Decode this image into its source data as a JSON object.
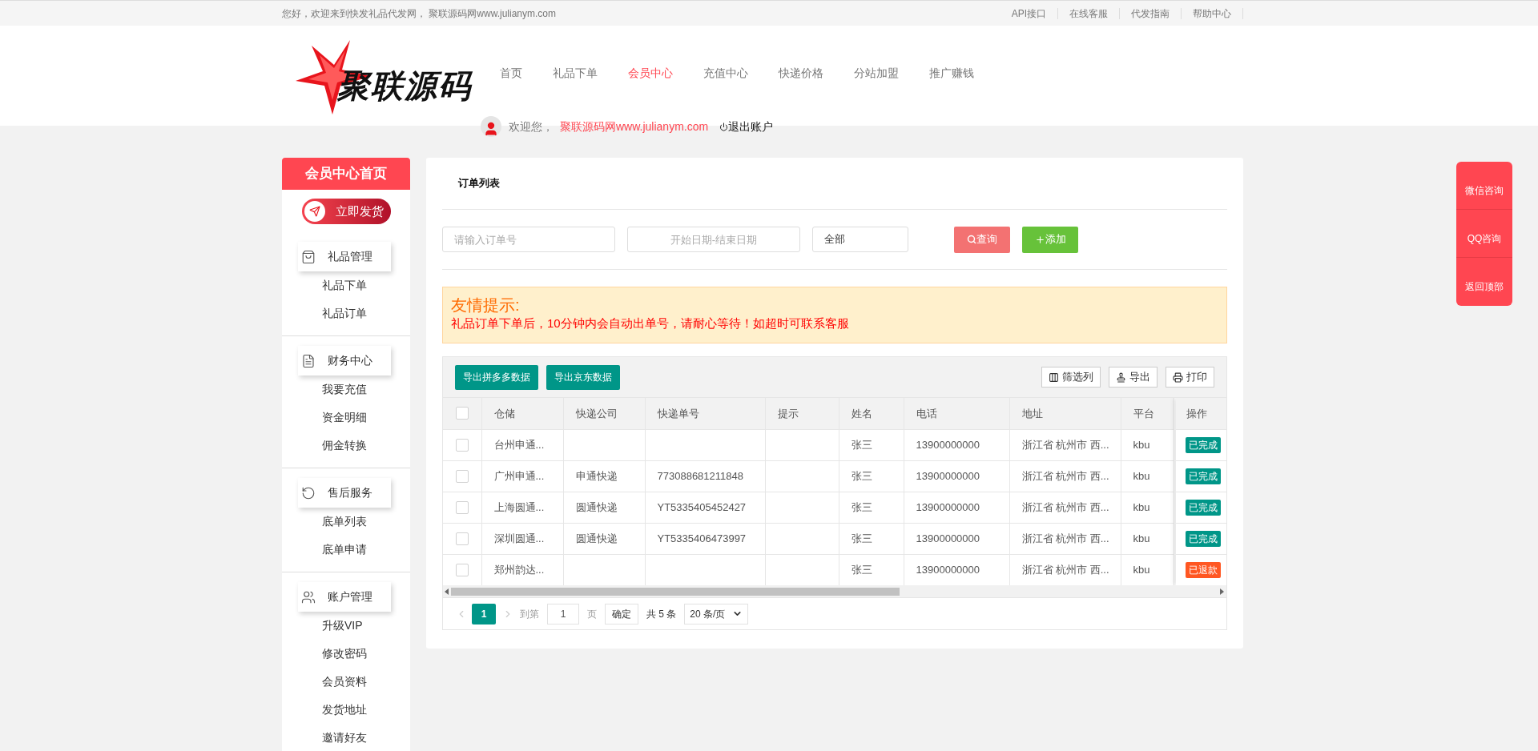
{
  "top_bar": {
    "greeting": "您好，欢迎来到快发礼品代发网， 聚联源码网www.julianym.com",
    "links": [
      "API接口",
      "在线客服",
      "代发指南",
      "帮助中心"
    ]
  },
  "header": {
    "logo_text": "聚联源码",
    "nav": [
      {
        "label": "首页",
        "selected": false
      },
      {
        "label": "礼品下单",
        "selected": false
      },
      {
        "label": "会员中心",
        "selected": true
      },
      {
        "label": "充值中心",
        "selected": false
      },
      {
        "label": "快递价格",
        "selected": false
      },
      {
        "label": "分站加盟",
        "selected": false
      },
      {
        "label": "推广赚钱",
        "selected": false
      }
    ],
    "user": {
      "greeting": "欢迎您，",
      "name": "聚联源码网www.julianym.com",
      "logout": "退出账户"
    }
  },
  "sidebar": {
    "title": "会员中心首页",
    "ship_button": "立即发货",
    "groups": [
      {
        "kind": "gift",
        "title": "礼品管理",
        "items": [
          "礼品下单",
          "礼品订单"
        ]
      },
      {
        "kind": "finance",
        "title": "财务中心",
        "items": [
          "我要充值",
          "资金明细",
          "佣金转换"
        ]
      },
      {
        "kind": "service",
        "title": "售后服务",
        "items": [
          "底单列表",
          "底单申请"
        ]
      },
      {
        "kind": "account",
        "title": "账户管理",
        "items": [
          "升级VIP",
          "修改密码",
          "会员资料",
          "发货地址",
          "邀请好友"
        ]
      }
    ]
  },
  "main": {
    "title": "订单列表",
    "search": {
      "order_placeholder": "请输入订单号",
      "date_placeholder": "开始日期-结束日期",
      "status_value": "全部",
      "query_button": "查询",
      "add_button": "添加"
    },
    "notice": {
      "title": "友情提示:",
      "text": "礼品订单下单后，10分钟内会自动出单号，请耐心等待！如超时可联系客服"
    },
    "toolbar": {
      "left_buttons": [
        "导出拼多多数据",
        "导出京东数据"
      ],
      "right_buttons": [
        {
          "kind": "columns",
          "label": "筛选列"
        },
        {
          "kind": "export",
          "label": "导出"
        },
        {
          "kind": "print",
          "label": "打印"
        }
      ]
    },
    "table": {
      "all_checked": false,
      "columns": [
        "仓储",
        "快递公司",
        "快递单号",
        "提示",
        "姓名",
        "电话",
        "地址",
        "平台"
      ],
      "action_column": "操作",
      "rows": [
        {
          "checked": false,
          "cells": [
            "台州申通...",
            "",
            "",
            "",
            "张三",
            "13900000000",
            "浙江省 杭州市 西...",
            "kbu"
          ],
          "status": {
            "kind": "done",
            "label": "已完成"
          }
        },
        {
          "checked": false,
          "cells": [
            "广州申通...",
            "申通快递",
            "773088681211848",
            "",
            "张三",
            "13900000000",
            "浙江省 杭州市 西...",
            "kbu"
          ],
          "status": {
            "kind": "done",
            "label": "已完成"
          }
        },
        {
          "checked": false,
          "cells": [
            "上海圆通...",
            "圆通快递",
            "YT5335405452427",
            "",
            "张三",
            "13900000000",
            "浙江省 杭州市 西...",
            "kbu"
          ],
          "status": {
            "kind": "done",
            "label": "已完成"
          }
        },
        {
          "checked": false,
          "cells": [
            "深圳圆通...",
            "圆通快递",
            "YT5335406473997",
            "",
            "张三",
            "13900000000",
            "浙江省 杭州市 西...",
            "kbu"
          ],
          "status": {
            "kind": "done",
            "label": "已完成"
          }
        },
        {
          "checked": false,
          "cells": [
            "郑州韵达...",
            "",
            "",
            "",
            "张三",
            "13900000000",
            "浙江省 杭州市 西...",
            "kbu"
          ],
          "status": {
            "kind": "refunded",
            "label": "已退款"
          }
        }
      ]
    },
    "pagination": {
      "pages": [
        {
          "label": "1",
          "selected": true
        }
      ],
      "goto_label": "到第",
      "page_value": "1",
      "page_unit": "页",
      "confirm": "确定",
      "total": "共 5 条",
      "page_size": "20 条/页"
    }
  },
  "float_menu": [
    "微信咨询",
    "QQ咨询",
    "返回顶部"
  ]
}
